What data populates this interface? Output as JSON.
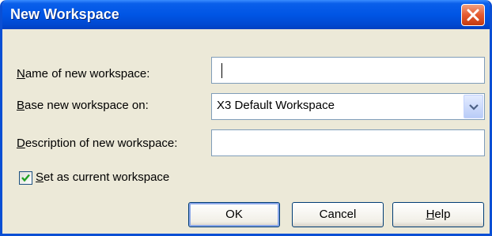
{
  "dialog": {
    "title": "New Workspace",
    "close_icon": "close-icon"
  },
  "form": {
    "name": {
      "label_first": "N",
      "label_rest": "ame of new workspace:",
      "value": ""
    },
    "base": {
      "label_first": "B",
      "label_rest": "ase new workspace on:",
      "selected": "X3 Default Workspace",
      "dropdown_icon": "chevron-down-icon"
    },
    "description": {
      "label_first": "D",
      "label_rest": "escription of new workspace:",
      "value": ""
    },
    "set_current": {
      "checked": true,
      "label_first": "S",
      "label_rest": "et as current workspace"
    }
  },
  "buttons": {
    "ok": "OK",
    "cancel": "Cancel",
    "help_first": "H",
    "help_rest": "elp"
  },
  "colors": {
    "accent": "#0A4FD4",
    "close": "#E55A2F",
    "dialog_bg": "#ECE9D8"
  }
}
